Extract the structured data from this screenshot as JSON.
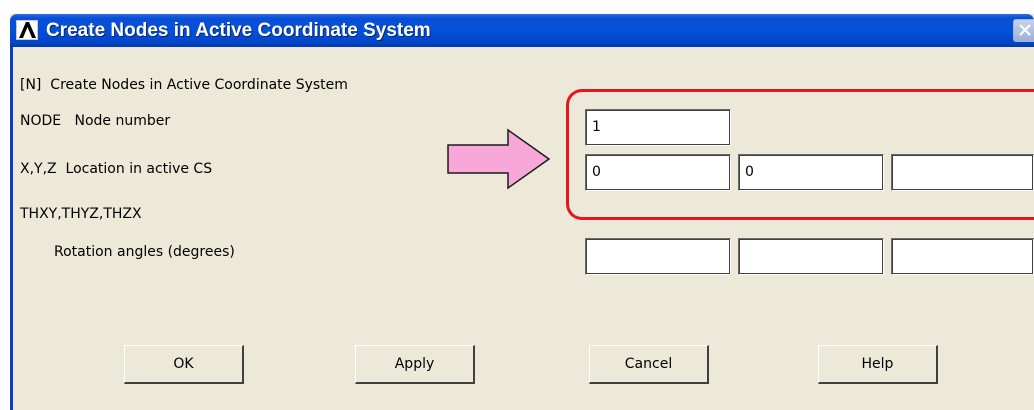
{
  "window": {
    "title": "Create Nodes in Active Coordinate System",
    "icon": "ansys-logo-icon",
    "title_bar_color": "#0350d8"
  },
  "header": {
    "command_label": "[N]  Create Nodes in Active Coordinate System"
  },
  "fields": {
    "node": {
      "label": "NODE   Node number",
      "value": "1"
    },
    "location": {
      "label": "X,Y,Z  Location in active CS",
      "x": "0",
      "y": "0",
      "z": ""
    },
    "rotation": {
      "label_line1": "THXY,THYZ,THZX",
      "label_line2": "Rotation angles (degrees)",
      "thxy": "",
      "thyz": "",
      "thzx": ""
    }
  },
  "buttons": {
    "ok": "OK",
    "apply": "Apply",
    "cancel": "Cancel",
    "help": "Help"
  },
  "annotation": {
    "arrow_color": "#f7a8d8",
    "highlight_color": "#e8141e"
  }
}
